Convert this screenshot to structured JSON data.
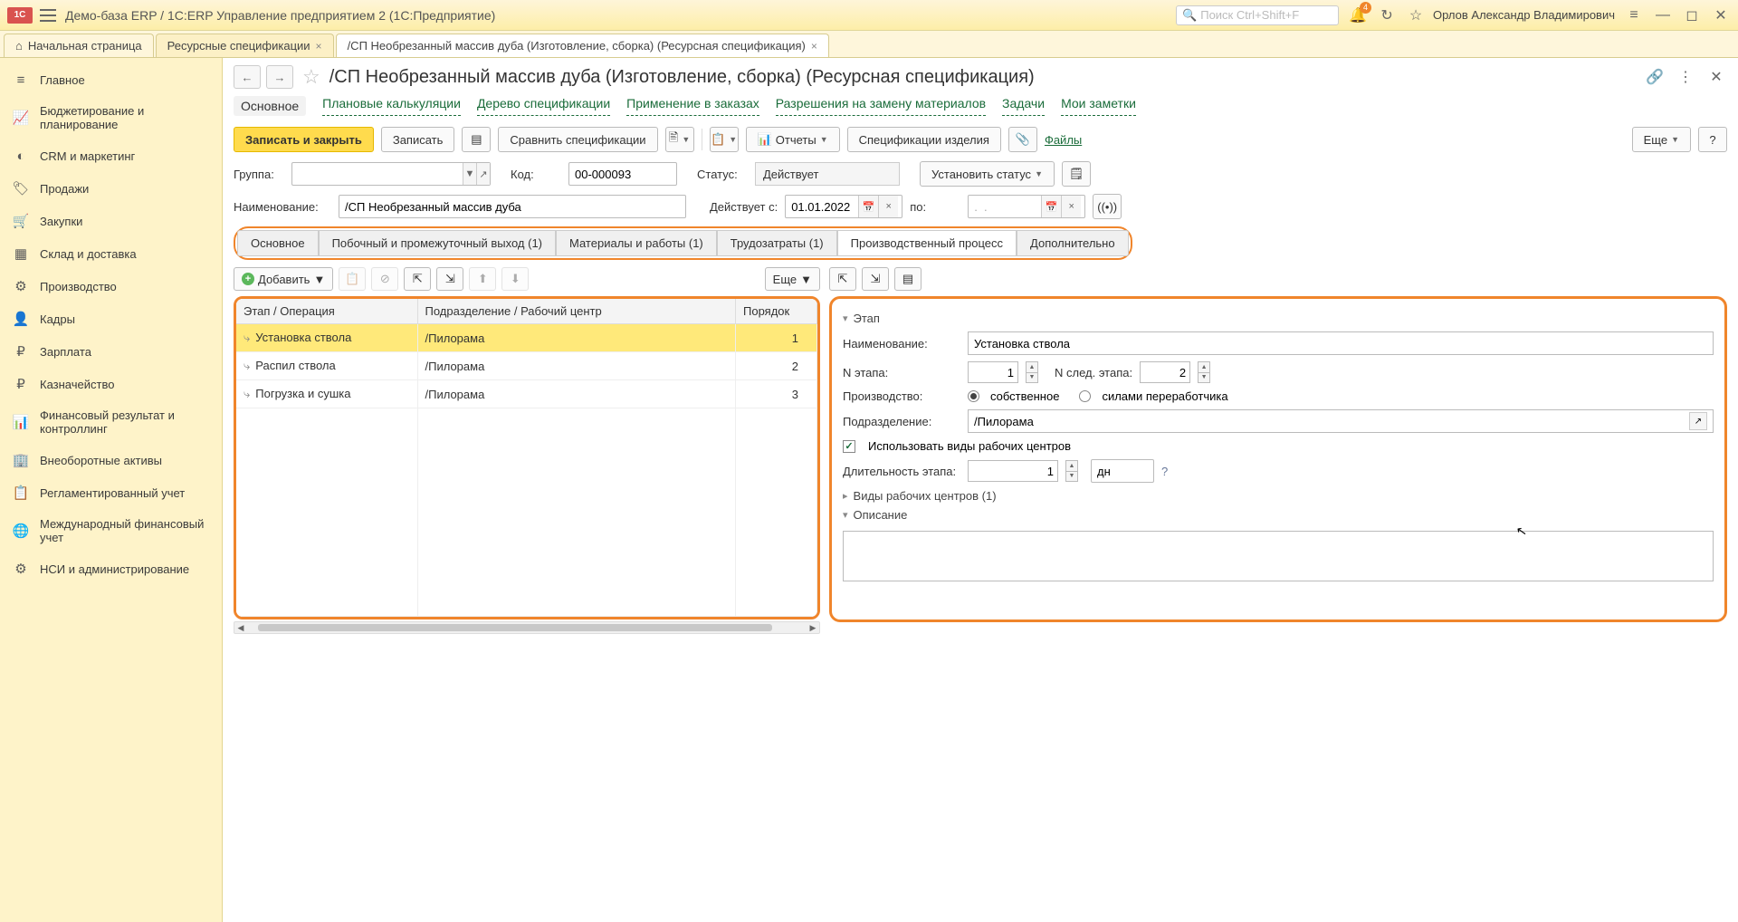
{
  "titlebar": {
    "logo_text": "1C",
    "title": "Демо-база ERP / 1C:ERP Управление предприятием 2  (1С:Предприятие)",
    "search_placeholder": "Поиск Ctrl+Shift+F",
    "badge_count": "4",
    "user": "Орлов Александр Владимирович"
  },
  "top_tabs": {
    "home": "Начальная страница",
    "t1": "Ресурсные спецификации",
    "t2": "/СП Необрезанный массив дуба (Изготовление, сборка) (Ресурсная спецификация)"
  },
  "sidebar": [
    {
      "icon": "≡",
      "label": "Главное"
    },
    {
      "icon": "📈",
      "label": "Бюджетирование и планирование"
    },
    {
      "icon": "◐",
      "label": "CRM и маркетинг"
    },
    {
      "icon": "🏷",
      "label": "Продажи"
    },
    {
      "icon": "🛒",
      "label": "Закупки"
    },
    {
      "icon": "▦",
      "label": "Склад и доставка"
    },
    {
      "icon": "⚙",
      "label": "Производство"
    },
    {
      "icon": "👤",
      "label": "Кадры"
    },
    {
      "icon": "₽",
      "label": "Зарплата"
    },
    {
      "icon": "₽",
      "label": "Казначейство"
    },
    {
      "icon": "📊",
      "label": "Финансовый результат и контроллинг"
    },
    {
      "icon": "🏢",
      "label": "Внеоборотные активы"
    },
    {
      "icon": "📋",
      "label": "Регламентированный учет"
    },
    {
      "icon": "🌐",
      "label": "Международный финансовый учет"
    },
    {
      "icon": "⚙",
      "label": "НСИ и администрирование"
    }
  ],
  "page": {
    "title": "/СП Необрезанный массив дуба (Изготовление, сборка) (Ресурсная спецификация)"
  },
  "linknav": {
    "l0": "Основное",
    "l1": "Плановые калькуляции",
    "l2": "Дерево спецификации",
    "l3": "Применение в заказах",
    "l4": "Разрешения на замену материалов",
    "l5": "Задачи",
    "l6": "Мои заметки"
  },
  "toolbar": {
    "save_close": "Записать и закрыть",
    "save": "Записать",
    "compare": "Сравнить спецификации",
    "reports": "Отчеты",
    "product_specs": "Спецификации изделия",
    "files": "Файлы",
    "more": "Еще",
    "help": "?"
  },
  "form": {
    "group_lbl": "Группа:",
    "code_lbl": "Код:",
    "code_val": "00-000093",
    "status_lbl": "Статус:",
    "status_val": "Действует",
    "set_status": "Установить статус",
    "name_lbl": "Наименование:",
    "name_val": "/СП Необрезанный массив дуба",
    "valid_from_lbl": "Действует с:",
    "valid_from_val": "01.01.2022",
    "to_lbl": "по:",
    "to_val": ".  ."
  },
  "inner_tabs": {
    "t0": "Основное",
    "t1": "Побочный и промежуточный выход (1)",
    "t2": "Материалы и работы (1)",
    "t3": "Трудозатраты (1)",
    "t4": "Производственный процесс",
    "t5": "Дополнительно"
  },
  "subtoolbar": {
    "add": "Добавить",
    "more": "Еще"
  },
  "table": {
    "h1": "Этап / Операция",
    "h2": "Подразделение / Рабочий центр",
    "h3": "Порядок",
    "rows": [
      {
        "name": "Установка ствола",
        "dept": "/Пилорама",
        "order": "1"
      },
      {
        "name": "Распил ствола",
        "dept": "/Пилорама",
        "order": "2"
      },
      {
        "name": "Погрузка и сушка",
        "dept": "/Пилорама",
        "order": "3"
      }
    ]
  },
  "detail": {
    "stage_head": "Этап",
    "name_lbl": "Наименование:",
    "name_val": "Установка ствола",
    "stage_n_lbl": "N этапа:",
    "stage_n_val": "1",
    "next_n_lbl": "N след. этапа:",
    "next_n_val": "2",
    "prod_lbl": "Производство:",
    "prod_own": "собственное",
    "prod_ext": "силами переработчика",
    "dept_lbl": "Подразделение:",
    "dept_val": "/Пилорама",
    "use_wc": "Использовать виды рабочих центров",
    "dur_lbl": "Длительность этапа:",
    "dur_val": "1",
    "dur_unit": "дн",
    "wc_head": "Виды рабочих центров (1)",
    "desc_head": "Описание"
  }
}
